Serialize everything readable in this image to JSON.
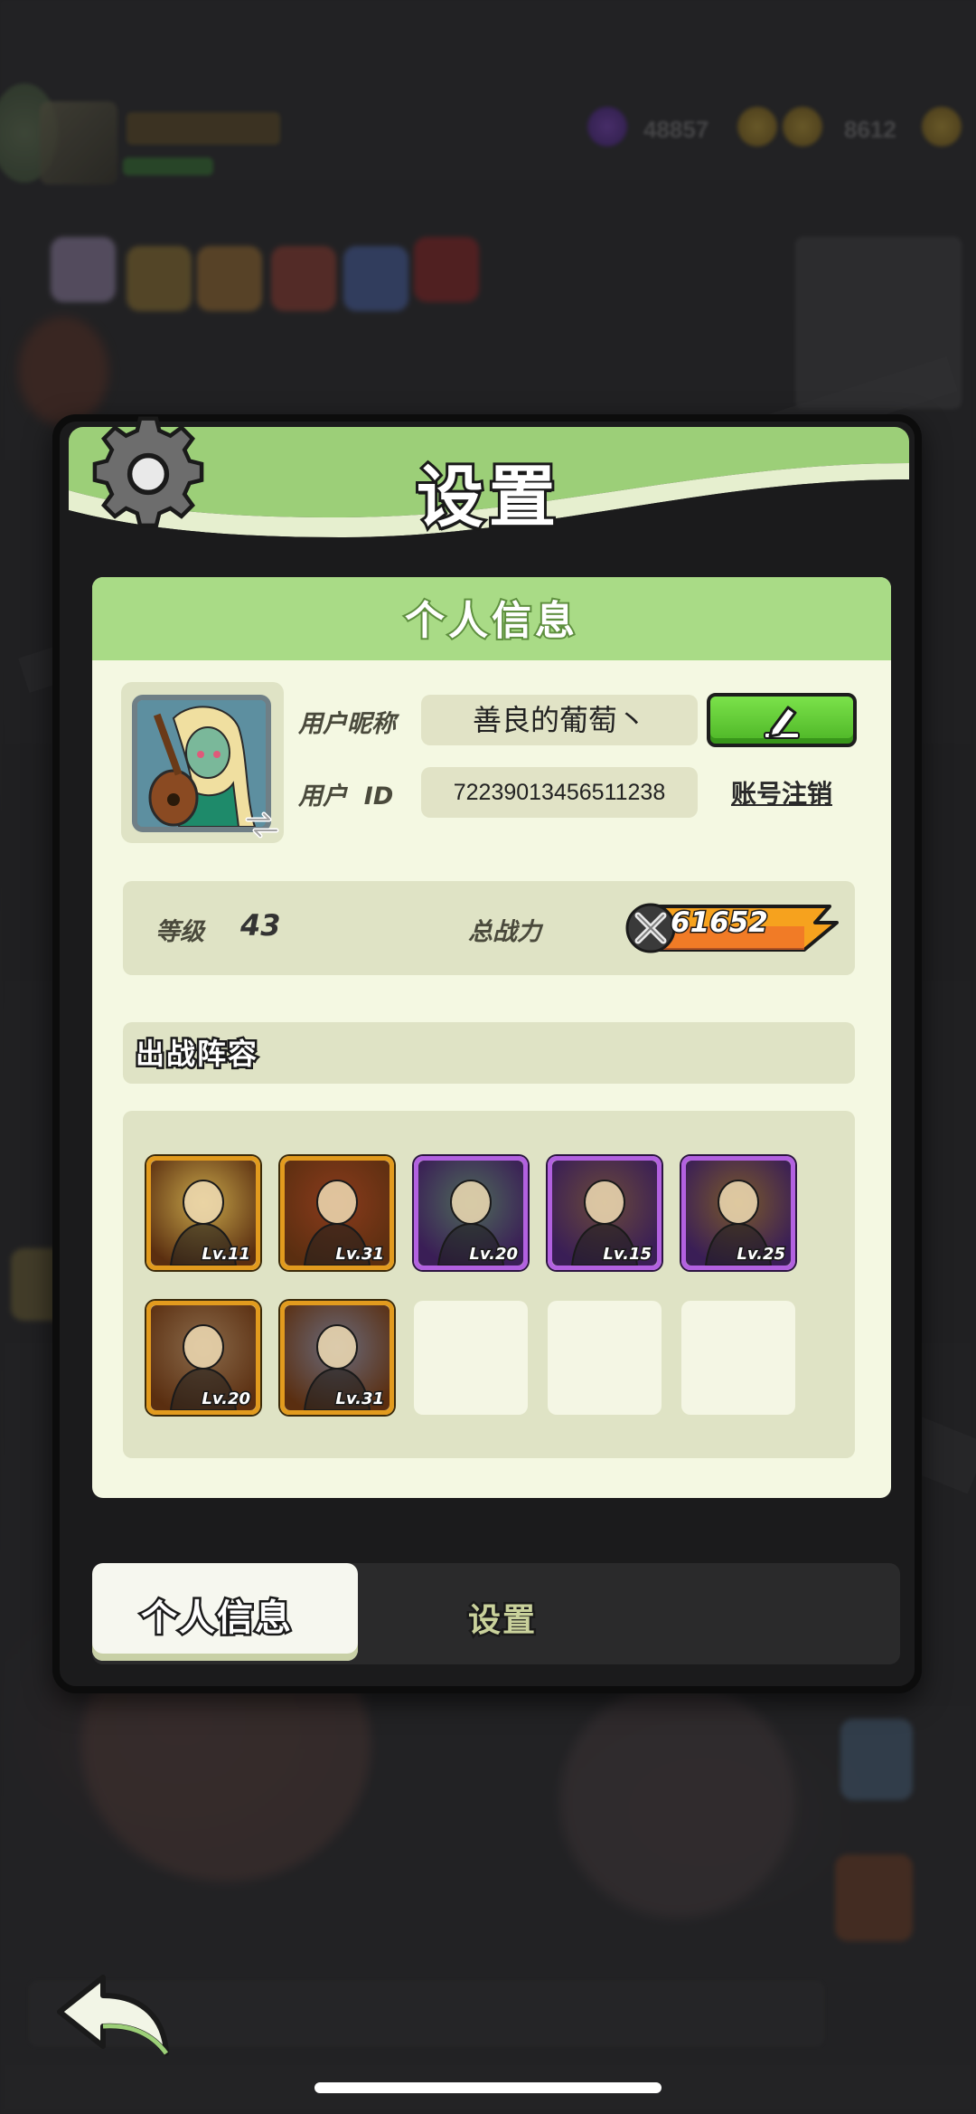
{
  "dialog": {
    "title": "设置",
    "section_title": "个人信息"
  },
  "profile": {
    "nickname_label": "用户昵称",
    "nickname": "善良的葡萄丶",
    "id_label": "用户  ID",
    "user_id": "72239013456511238",
    "account_cancel": "账号注销"
  },
  "stats": {
    "level_label": "等级",
    "level": "43",
    "power_label": "总战力",
    "power": "61652"
  },
  "lineup": {
    "title": "出战阵容",
    "heroes": [
      {
        "rarity": "gold",
        "level_text": "Lv.11",
        "color": "#c7a64a"
      },
      {
        "rarity": "gold",
        "level_text": "Lv.31",
        "color": "#8a3b1c"
      },
      {
        "rarity": "purple",
        "level_text": "Lv.20",
        "color": "#4e6a5a"
      },
      {
        "rarity": "purple",
        "level_text": "Lv.15",
        "color": "#6a4a3a"
      },
      {
        "rarity": "purple",
        "level_text": "Lv.25",
        "color": "#7a5a2a"
      },
      {
        "rarity": "gold",
        "level_text": "Lv.20",
        "color": "#8a6a4a"
      },
      {
        "rarity": "gold",
        "level_text": "Lv.31",
        "color": "#6a6a7a"
      },
      {
        "rarity": "empty",
        "level_text": ""
      },
      {
        "rarity": "empty",
        "level_text": ""
      },
      {
        "rarity": "empty",
        "level_text": ""
      }
    ]
  },
  "tabs": {
    "personal": "个人信息",
    "settings": "设置"
  },
  "colors": {
    "header_green": "#9ccf78",
    "panel_bg": "#f4f8e2",
    "edit_green": "#5fcb34",
    "gold_frame": "#e29b1e",
    "purple_frame": "#b261e0"
  },
  "icons": {
    "header": "gear-icon",
    "edit": "pencil-icon",
    "power": "crossed-swords-icon",
    "back": "back-arrow-icon",
    "avatar_swap": "swap-icon"
  }
}
